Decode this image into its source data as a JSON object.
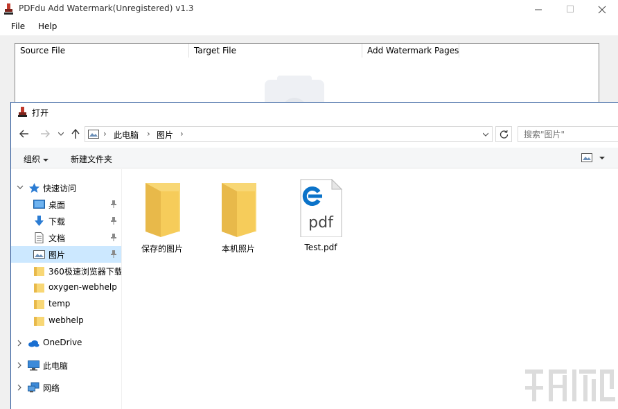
{
  "app": {
    "title": "PDFdu Add Watermark(Unregistered) v1.3",
    "menu": [
      "File",
      "Help"
    ],
    "columns": [
      "Source File",
      "Target File",
      "Add Watermark Pages"
    ]
  },
  "dialog": {
    "title": "打开",
    "breadcrumb": [
      "此电脑",
      "图片"
    ],
    "search_placeholder": "搜索\"图片\"",
    "toolbar": {
      "organize": "组织",
      "new_folder": "新建文件夹"
    },
    "nav_items": [
      {
        "label": "快速访问",
        "icon": "star-icon",
        "expandable": true,
        "expanded": true
      },
      {
        "label": "桌面",
        "icon": "desktop-icon",
        "pinned": true
      },
      {
        "label": "下载",
        "icon": "download-icon",
        "pinned": true
      },
      {
        "label": "文档",
        "icon": "document-icon",
        "pinned": true
      },
      {
        "label": "图片",
        "icon": "pictures-icon",
        "pinned": true,
        "selected": true
      },
      {
        "label": "360极速浏览器下载",
        "icon": "folder-icon"
      },
      {
        "label": "oxygen-webhelp",
        "icon": "folder-icon"
      },
      {
        "label": "temp",
        "icon": "folder-icon"
      },
      {
        "label": "webhelp",
        "icon": "folder-icon"
      },
      {
        "label": "OneDrive",
        "icon": "cloud-icon",
        "expandable": true
      },
      {
        "label": "此电脑",
        "icon": "computer-icon",
        "expandable": true
      },
      {
        "label": "网络",
        "icon": "network-icon",
        "expandable": true
      }
    ],
    "files": [
      {
        "name": "保存的图片",
        "type": "folder"
      },
      {
        "name": "本机照片",
        "type": "folder"
      },
      {
        "name": "Test.pdf",
        "type": "pdf",
        "icon_text": "pdf"
      }
    ]
  },
  "colors": {
    "folder": "#f8d775",
    "selection": "#cce8ff",
    "pdf_blue": "#0b73c9",
    "dialog_border": "#2b579a"
  }
}
